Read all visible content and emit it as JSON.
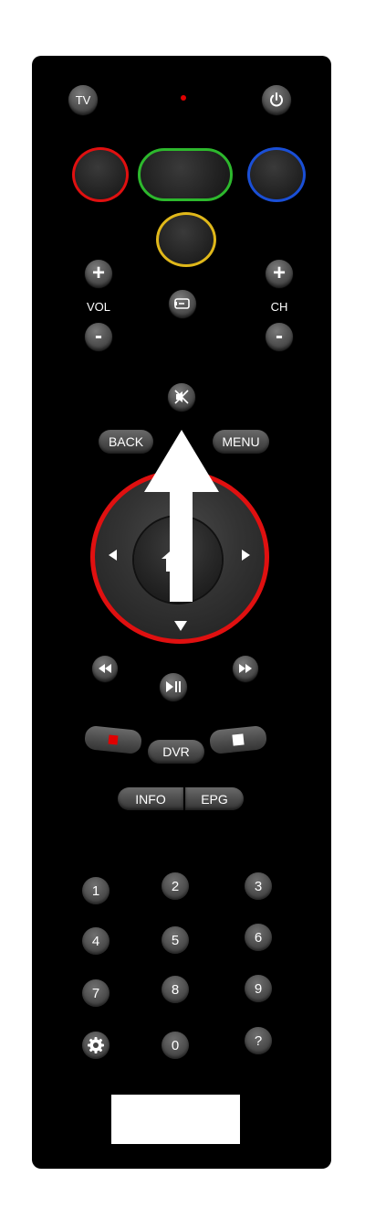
{
  "top": {
    "tv_label": "TV",
    "power_icon": "power-icon",
    "led_color": "#e00000"
  },
  "color_keys": {
    "red": "#e01010",
    "green": "#2db82d",
    "blue": "#1a4fd6",
    "yellow": "#e0b81a"
  },
  "volume": {
    "plus": "+",
    "label": "VOL",
    "minus": "-"
  },
  "channel": {
    "plus": "+",
    "label": "CH",
    "minus": "-"
  },
  "center_icon": "source-icon",
  "mute_icon": "mute-icon",
  "nav": {
    "back_label": "BACK",
    "menu_label": "MENU",
    "ring_color": "#e01010"
  },
  "overlay_arrow": {
    "icon": "up-arrow-icon",
    "color": "#ffffff"
  },
  "playback": {
    "rewind_icon": "rewind-icon",
    "forward_icon": "fast-forward-icon",
    "play_pause_icon": "play-pause-icon"
  },
  "dvr": {
    "record_icon": "record-icon",
    "label": "DVR",
    "stop_icon": "stop-icon"
  },
  "info_label": "INFO",
  "epg_label": "EPG",
  "numpad": {
    "keys": [
      "1",
      "2",
      "3",
      "4",
      "5",
      "6",
      "7",
      "8",
      "9",
      "",
      "0",
      "?"
    ],
    "settings_icon": "gear-icon"
  }
}
